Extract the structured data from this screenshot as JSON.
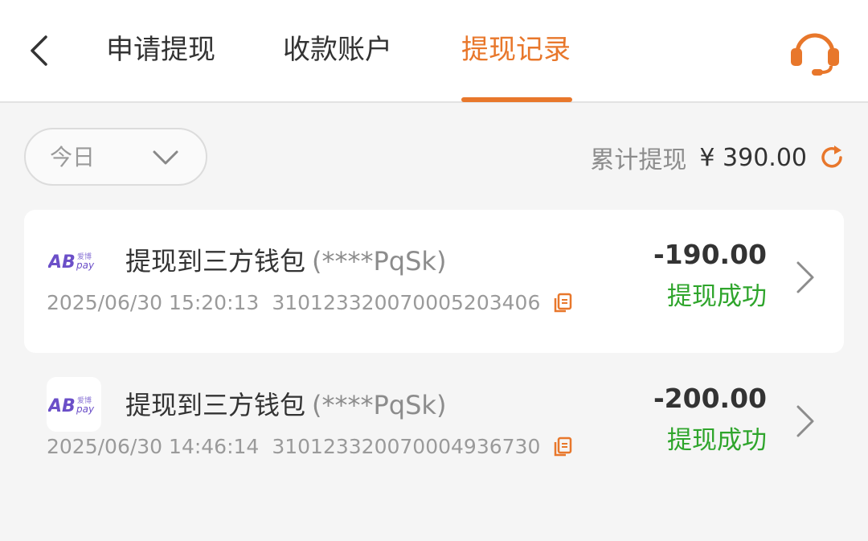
{
  "header": {
    "tabs": [
      {
        "label": "申请提现",
        "active": false
      },
      {
        "label": "收款账户",
        "active": false
      },
      {
        "label": "提现记录",
        "active": true
      }
    ],
    "back_icon": "chevron-left-icon",
    "support_icon": "headset-icon"
  },
  "filter": {
    "selected": "今日"
  },
  "summary": {
    "label": "累计提现",
    "amount": "¥ 390.00",
    "refresh_icon": "refresh-icon"
  },
  "records": [
    {
      "title": "提现到三方钱包",
      "account": "(****PqSk)",
      "datetime": "2025/06/30 15:20:13",
      "txn_id": "3101233200700052034​06",
      "amount": "-190.00",
      "status": "提现成功",
      "logo": "ab-pay-logo"
    },
    {
      "title": "提现到三方钱包",
      "account": "(****PqSk)",
      "datetime": "2025/06/30 14:46:14",
      "txn_id": "3101233200700049367​30",
      "amount": "-200.00",
      "status": "提现成功",
      "logo": "ab-pay-logo"
    }
  ],
  "colors": {
    "accent": "#e8772b",
    "success": "#2fa52c",
    "logo_purple": "#6b4fc8"
  }
}
